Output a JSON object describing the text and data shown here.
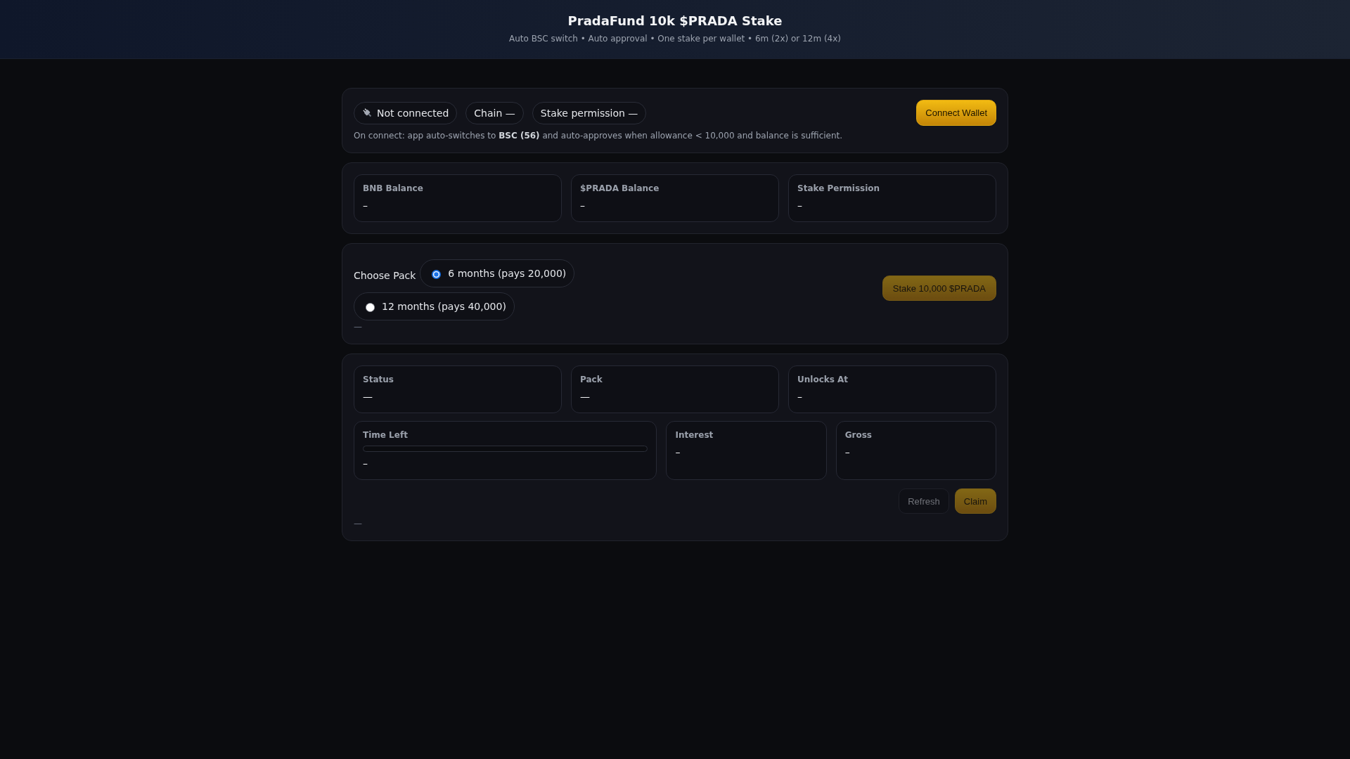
{
  "header": {
    "title": "PradaFund 10k $PRADA Stake",
    "subtitle": "Auto BSC switch • Auto approval • One stake per wallet • 6m (2x) or 12m (4x)"
  },
  "connection": {
    "chips": [
      {
        "kind": "connection",
        "label": "Not connected"
      },
      {
        "kind": "chain",
        "label": "Chain —"
      },
      {
        "kind": "permission",
        "label": "Stake permission —"
      }
    ],
    "button": {
      "label": "Connect Wallet",
      "disabled": false
    },
    "note": "On connect: app auto-switches to **BSC (56)** and auto-approves when allowance < 10,000 and balance is sufficient."
  },
  "balances": [
    {
      "label": "BNB Balance",
      "value": "–"
    },
    {
      "label": "$PRADA Balance",
      "value": "–"
    },
    {
      "label": "Stake Permission",
      "value": "–"
    }
  ],
  "pack": {
    "label": "Choose Pack",
    "options": [
      {
        "label": "6 months (pays 20,000)",
        "selected": true
      },
      {
        "label": "12 months (pays 40,000)",
        "selected": false
      }
    ],
    "message": "—",
    "button": {
      "label": "Stake 10,000 $PRADA",
      "disabled": true
    }
  },
  "position": {
    "stats": [
      {
        "label": "Status",
        "value": "—"
      },
      {
        "label": "Pack",
        "value": "—"
      },
      {
        "label": "Unlocks At",
        "value": "–"
      }
    ],
    "time_left": {
      "label": "Time Left",
      "value": "–"
    },
    "totals": [
      {
        "label": "Interest",
        "value": "–"
      },
      {
        "label": "Gross",
        "value": "–"
      }
    ],
    "buttons": [
      {
        "kind": "secondary",
        "label": "Refresh",
        "disabled": true
      },
      {
        "kind": "primary",
        "label": "Claim",
        "disabled": true
      }
    ],
    "message": "—"
  }
}
